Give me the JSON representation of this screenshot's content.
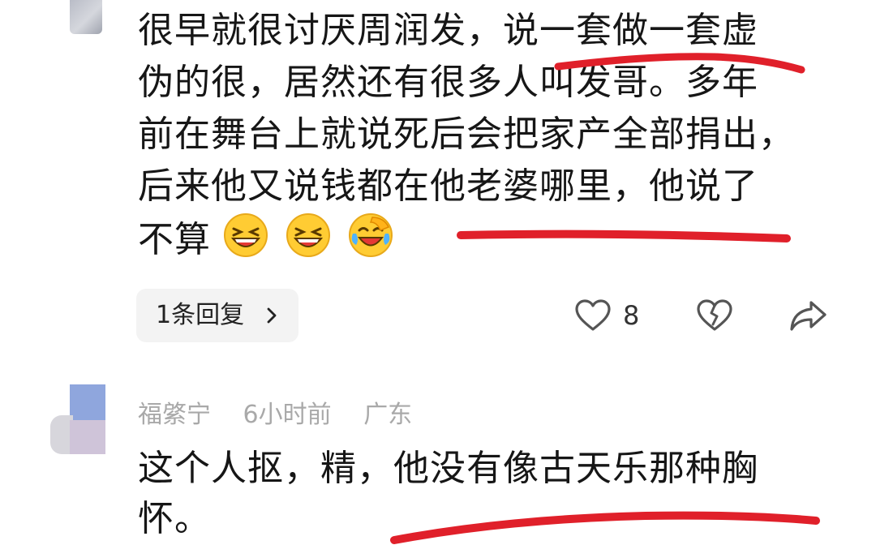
{
  "comment1": {
    "lines": [
      "很早就很讨厌周润发，说一套做一套虚",
      "伪的很，居然还有很多人叫发哥。多年",
      "前在舞台上就说死后会把家产全部捐出，",
      "后来他又说钱都在他老婆哪里，他说了",
      "不算"
    ],
    "emojis": [
      "grin-squint-icon",
      "grin-squint-icon",
      "laugh-cry-icon"
    ],
    "reply_label": "1条回复",
    "like_count": "8"
  },
  "comment2": {
    "author": "福綮宁",
    "time": "6小时前",
    "location": "广东",
    "lines": [
      "这个人抠，精，他没有像古天乐那种胸",
      "怀。"
    ]
  },
  "colors": {
    "underline": "#e0202a",
    "meta": "#a9a9a9",
    "pill": "#f3f3f3"
  }
}
